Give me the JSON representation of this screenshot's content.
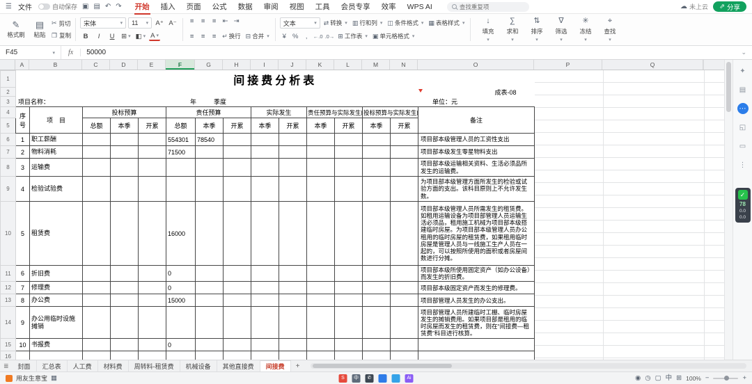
{
  "titlebar": {
    "file": "文件",
    "autosave": "自动保存",
    "tabs": [
      "开始",
      "插入",
      "页面",
      "公式",
      "数据",
      "审阅",
      "视图",
      "工具",
      "会员专享",
      "效率",
      "WPS AI"
    ],
    "active_tab": "开始",
    "search_placeholder": "查找重复项",
    "cloud_status": "未上云",
    "share": "分享"
  },
  "ribbon": {
    "format_painter": "格式刷",
    "paste": "粘贴",
    "cut": "剪切",
    "copy": "复制",
    "font_name": "宋体",
    "font_size": "11",
    "grow_font": "A⁺",
    "shrink_font": "A⁻",
    "bold": "B",
    "italic": "I",
    "underline": "U",
    "wrap": "换行",
    "merge": "合并",
    "number_format": "文本",
    "convert": "转换",
    "rows_cols": "行和列",
    "cond_format": "条件格式",
    "table_style": "表格样式",
    "worksheet": "工作表",
    "cell_format": "单元格格式",
    "stack": [
      "填充",
      "求和",
      "排序",
      "筛选",
      "冻结",
      "查找"
    ],
    "stack_icons": [
      "icon-fill",
      "icon-sum",
      "icon-sort",
      "icon-filter",
      "icon-freeze",
      "icon-find"
    ]
  },
  "formula_bar": {
    "cell_ref": "F45",
    "fx": "fx",
    "value": "50000"
  },
  "grid": {
    "columns": [
      "A",
      "B",
      "C",
      "D",
      "E",
      "F",
      "G",
      "H",
      "I",
      "J",
      "K",
      "L",
      "M",
      "N",
      "O",
      "P",
      "Q"
    ],
    "selected_column": "F",
    "row_labels": [
      "1",
      "2",
      "3",
      "4",
      "5"
    ]
  },
  "sheet": {
    "title": "间接费分析表",
    "form_code": "成表-08",
    "project_label": "项目名称：",
    "year_label": "年",
    "quarter_label": "季度",
    "unit_label": "单位：元",
    "table": {
      "seq_header": "序号",
      "item_header": "项　目",
      "groups": [
        "投标预算",
        "责任预算",
        "实际发生",
        "责任预算与实际发生的差",
        "投标预算与实际发生的差"
      ],
      "subs": [
        "总额",
        "本季",
        "开累",
        "总额",
        "本季",
        "开累",
        "本季",
        "开累",
        "本季",
        "开累",
        "本季",
        "开累"
      ],
      "note_header": "备注",
      "rows": [
        [
          "6",
          "1",
          "职工薪酬",
          "",
          "",
          "",
          "554301",
          "78540",
          "",
          "",
          "",
          "",
          "",
          "",
          "",
          "项目部本级管理人员的工资性支出"
        ],
        [
          "7",
          "2",
          "物料消耗",
          "",
          "",
          "",
          "71500",
          "",
          "",
          "",
          "",
          "",
          "",
          "",
          "",
          "项目部本级发生零星物料支出"
        ],
        [
          "8",
          "3",
          "运输费",
          "",
          "",
          "",
          "",
          "",
          "",
          "",
          "",
          "",
          "",
          "",
          "",
          "项目部本级运输相关资料、生活必须品所发生的运输费。"
        ],
        [
          "9",
          "4",
          "检验试验费",
          "",
          "",
          "",
          "",
          "",
          "",
          "",
          "",
          "",
          "",
          "",
          "",
          "为项目部本级管理方面所发生的检验或试验方面的支出。该科目原则上不允许发生数。"
        ],
        [
          "10",
          "5",
          "租赁费",
          "",
          "",
          "",
          "16000",
          "",
          "",
          "",
          "",
          "",
          "",
          "",
          "",
          "项目部本级管理人员所需发生的租赁费。如租用运输设备为项目部管理人员运输生活必须品，租用施工机械为项目部本级搭建临时房屋。为项目部本级管理人员办公租用的临时房屋的租赁费，如果租用临时房屋是管理人员与一线施工生产人员在一起的，可以按照所使用的面积或者房屋间数进行分摊。"
        ],
        [
          "11",
          "6",
          "折旧费",
          "",
          "",
          "",
          "0",
          "",
          "",
          "",
          "",
          "",
          "",
          "",
          "",
          "项目部本级所使用固定资产（如办公设备）而发生的折旧费。"
        ],
        [
          "12",
          "7",
          "修理费",
          "",
          "",
          "",
          "0",
          "",
          "",
          "",
          "",
          "",
          "",
          "",
          "",
          "项目部本级固定资产而发生的修理费。"
        ],
        [
          "13",
          "8",
          "办公费",
          "",
          "",
          "",
          "15000",
          "",
          "",
          "",
          "",
          "",
          "",
          "",
          "",
          "项目部管理人员发生的办公支出。"
        ],
        [
          "14",
          "9",
          "办公用临时设施摊销",
          "",
          "",
          "",
          "",
          "",
          "",
          "",
          "",
          "",
          "",
          "",
          "",
          "项目部管理人员所建临时工棚、临时房屋发生的摊销费用。如果项目部是租用的临时房屋而发生的租赁费，则在“间接费—租赁费”科目进行核算。"
        ],
        [
          "15",
          "10",
          "书报费",
          "",
          "",
          "",
          "0",
          "",
          "",
          "",
          "",
          "",
          "",
          "",
          "",
          ""
        ],
        [
          "16",
          "",
          "",
          "",
          "",
          "",
          "",
          "",
          "",
          "",
          "",
          "",
          "",
          "",
          "",
          ""
        ]
      ]
    }
  },
  "sheet_tabs": {
    "tabs": [
      "封面",
      "汇总表",
      "人工费",
      "材料费",
      "周转料-租赁费",
      "机械设备",
      "其他直接费",
      "间接费"
    ],
    "active": "间接费",
    "add": "+"
  },
  "side_panel": {
    "icons": [
      {
        "name": "skin-icon",
        "glyph": "✦"
      },
      {
        "name": "document-assistant-icon",
        "glyph": "▤"
      },
      {
        "name": "chat-icon",
        "glyph": "⋯",
        "bg": "#2b7de9",
        "fg": "#fff"
      },
      {
        "name": "collaborate-icon",
        "glyph": "◱"
      },
      {
        "name": "comment-icon",
        "glyph": "▭"
      },
      {
        "name": "more-icon",
        "glyph": "⋮"
      }
    ],
    "widget": {
      "score": "78",
      "up": "0.0",
      "down": "0.0"
    }
  },
  "taskbar": {
    "launcher_label": "用友生意宝",
    "zoom": "100%",
    "app_icons": [
      {
        "name": "wps-taskbar-icon",
        "color": "#e64a3c",
        "glyph": "S"
      },
      {
        "name": "input-method-icon",
        "color": "#5f6b7a",
        "glyph": "中"
      },
      {
        "name": "phone-link-icon",
        "color": "#3d4752",
        "glyph": "✆"
      },
      {
        "name": "app-blue-icon",
        "color": "#2f7ce8",
        "glyph": ""
      },
      {
        "name": "app-teal-icon",
        "color": "#35a3e8",
        "glyph": ""
      },
      {
        "name": "ai-assistant-icon",
        "color": "#8a5cf5",
        "glyph": "Ai"
      }
    ],
    "tray_icons": [
      {
        "name": "eye-protect-icon",
        "glyph": "◉"
      },
      {
        "name": "clock-icon",
        "glyph": "◷"
      },
      {
        "name": "window-icon",
        "glyph": "▢"
      },
      {
        "name": "language-icon",
        "glyph": "中"
      },
      {
        "name": "grid-icon",
        "glyph": "⊞"
      }
    ]
  }
}
